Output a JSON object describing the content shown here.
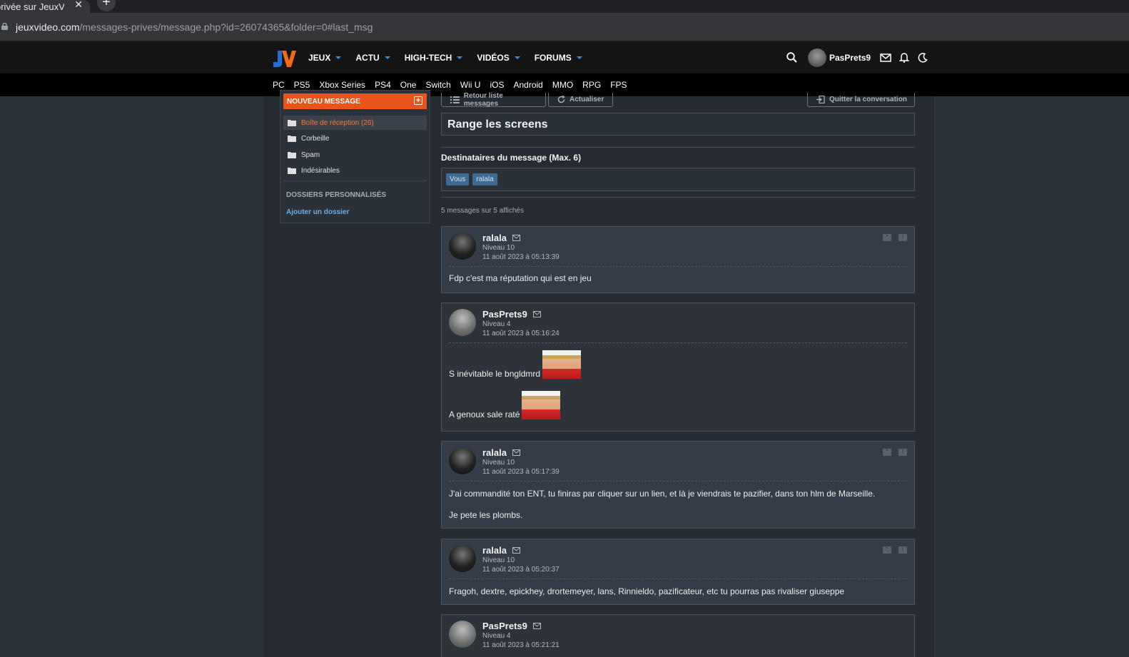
{
  "browser": {
    "tab_title": "privée sur JeuxVid",
    "url_host": "jeuxvideo.com",
    "url_path": "/messages-prives/message.php?id=26074365&folder=0#last_msg"
  },
  "nav": {
    "menu": [
      "JEUX",
      "ACTU",
      "HIGH-TECH",
      "VIDÉOS",
      "FORUMS"
    ],
    "username": "PasPrets9",
    "platforms": [
      "PC",
      "PS5",
      "Xbox Series",
      "PS4",
      "One",
      "Switch",
      "Wii U",
      "iOS",
      "Android",
      "MMO",
      "RPG",
      "FPS"
    ]
  },
  "sidebar": {
    "new_message": "NOUVEAU MESSAGE",
    "folders": [
      "Boîte de réception (26)",
      "Corbeille",
      "Spam",
      "Indésirables"
    ],
    "custom_heading": "DOSSIERS PERSONNALISÉS",
    "add_folder": "Ajouter un dossier"
  },
  "main": {
    "back_button": "Retour liste messages",
    "refresh_button": "Actualiser",
    "leave_button": "Quitter la conversation",
    "subject": "Range les screens",
    "recipients_label": "Destinataires du message (Max. 6)",
    "recipients": [
      "Vous",
      "ralala"
    ],
    "count_text": "5 messages sur 5 affichés"
  },
  "messages": [
    {
      "author": "ralala",
      "level": "Niveau 10",
      "date": "11 août 2023 à 05:13:39",
      "lines": [
        "Fdp c'est ma réputation qui est en jeu"
      ]
    },
    {
      "author": "PasPrets9",
      "level": "Niveau 4",
      "date": "11 août 2023 à 05:16:24",
      "lines": [
        "S inévitable le bngldmrd",
        "A genoux sale raté"
      ]
    },
    {
      "author": "ralala",
      "level": "Niveau 10",
      "date": "11 août 2023 à 05:17:39",
      "lines": [
        "J'ai commandité ton ENT, tu finiras par cliquer sur un lien, et là je viendrais te pazifier, dans ton hlm de Marseille.",
        "Je pete les plombs."
      ]
    },
    {
      "author": "ralala",
      "level": "Niveau 10",
      "date": "11 août 2023 à 05:20:37",
      "lines": [
        "Fragoh, dextre, epickhey, drortemeyer, lans, Rinnieldo, pazificateur, etc tu pourras pas rivaliser giuseppe"
      ]
    },
    {
      "author": "PasPrets9",
      "level": "Niveau 4",
      "date": "11 août 2023 à 05:21:21",
      "lines": []
    }
  ],
  "colors": {
    "accent_orange": "#e8541c",
    "link_blue": "#6ab0e8",
    "chip_blue": "#3f6a91"
  }
}
